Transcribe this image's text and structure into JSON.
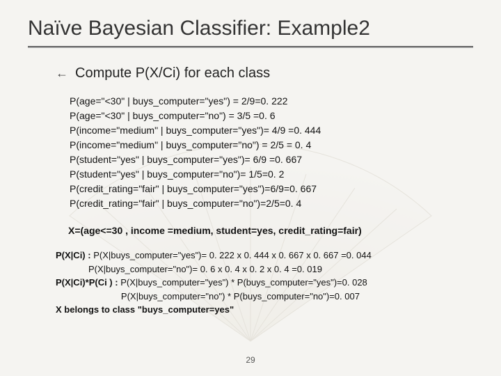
{
  "title": "Naïve Bayesian Classifier:  Example2",
  "lead": "Compute P(X/Ci) for each class",
  "probs": [
    "P(age=\"<30\" | buys_computer=\"yes\")  = 2/9=0. 222",
    "P(age=\"<30\" | buys_computer=\"no\") = 3/5 =0. 6",
    "P(income=\"medium\" | buys_computer=\"yes\")= 4/9 =0. 444",
    "P(income=\"medium\" | buys_computer=\"no\") = 2/5 = 0. 4",
    "P(student=\"yes\" | buys_computer=\"yes\")= 6/9 =0. 667",
    "P(student=\"yes\" | buys_computer=\"no\")= 1/5=0. 2",
    "P(credit_rating=\"fair\" | buys_computer=\"yes\")=6/9=0. 667",
    "P(credit_rating=\"fair\" | buys_computer=\"no\")=2/5=0. 4"
  ],
  "xline": "X=(age<=30 , income =medium, student=yes, credit_rating=fair)",
  "calc": {
    "l1a": "P(X|Ci) : ",
    "l1b": "P(X|buys_computer=\"yes\")= 0. 222 x 0. 444 x 0. 667 x 0. 667 =0. 044",
    "l2": "             P(X|buys_computer=\"no\")= 0. 6 x 0. 4 x 0. 2 x 0. 4 =0. 019",
    "l3a": "P(X|Ci)*P(Ci ) : ",
    "l3b": "P(X|buys_computer=\"yes\") * P(buys_computer=\"yes\")=0. 028",
    "l4": "                          P(X|buys_computer=\"no\") * P(buys_computer=\"no\")=0. 007",
    "l5": "X belongs to class \"buys_computer=yes\""
  },
  "pagenum": "29"
}
